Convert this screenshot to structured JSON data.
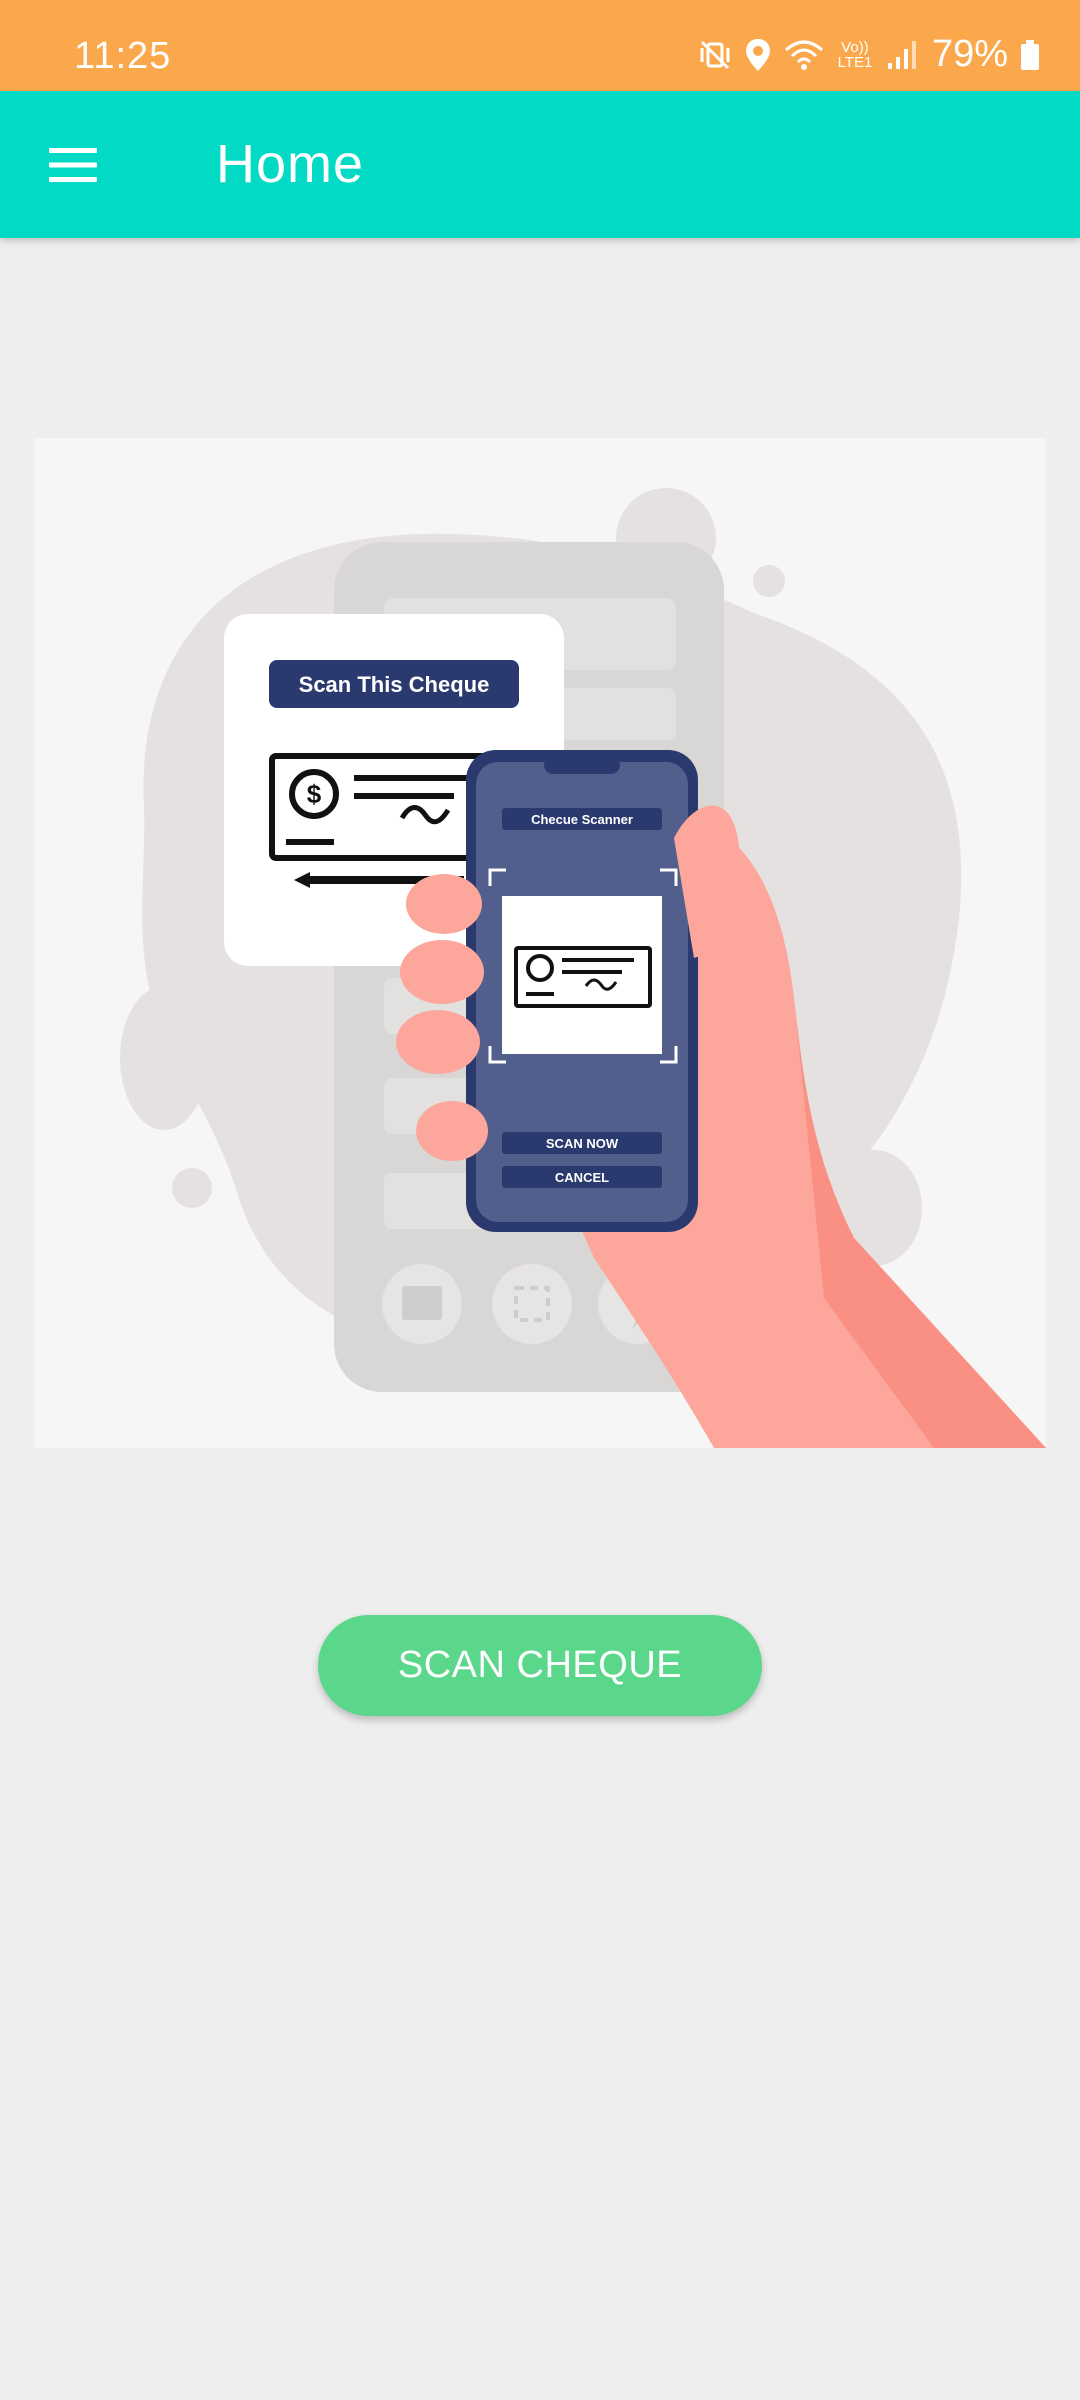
{
  "status_bar": {
    "time": "11:25",
    "network_label": "Vo)) LTE1",
    "battery_text": "79%",
    "icons": [
      "mute-vibrate-icon",
      "location-icon",
      "wifi-icon",
      "signal-icon",
      "battery-icon"
    ]
  },
  "app_bar": {
    "title": "Home",
    "menu_icon": "hamburger-menu-icon"
  },
  "illustration": {
    "card_title": "Scan This Cheque",
    "phone_header": "Checue Scanner",
    "phone_scan_label": "SCAN NOW",
    "phone_cancel_label": "CANCEL"
  },
  "actions": {
    "scan_button_label": "SCAN CHEQUE"
  },
  "colors": {
    "status_bar": "#fba84c",
    "app_bar": "#02dac5",
    "background": "#eeeeee",
    "primary_button": "#5bd78c",
    "illustration_navy": "#2b3a6e"
  }
}
